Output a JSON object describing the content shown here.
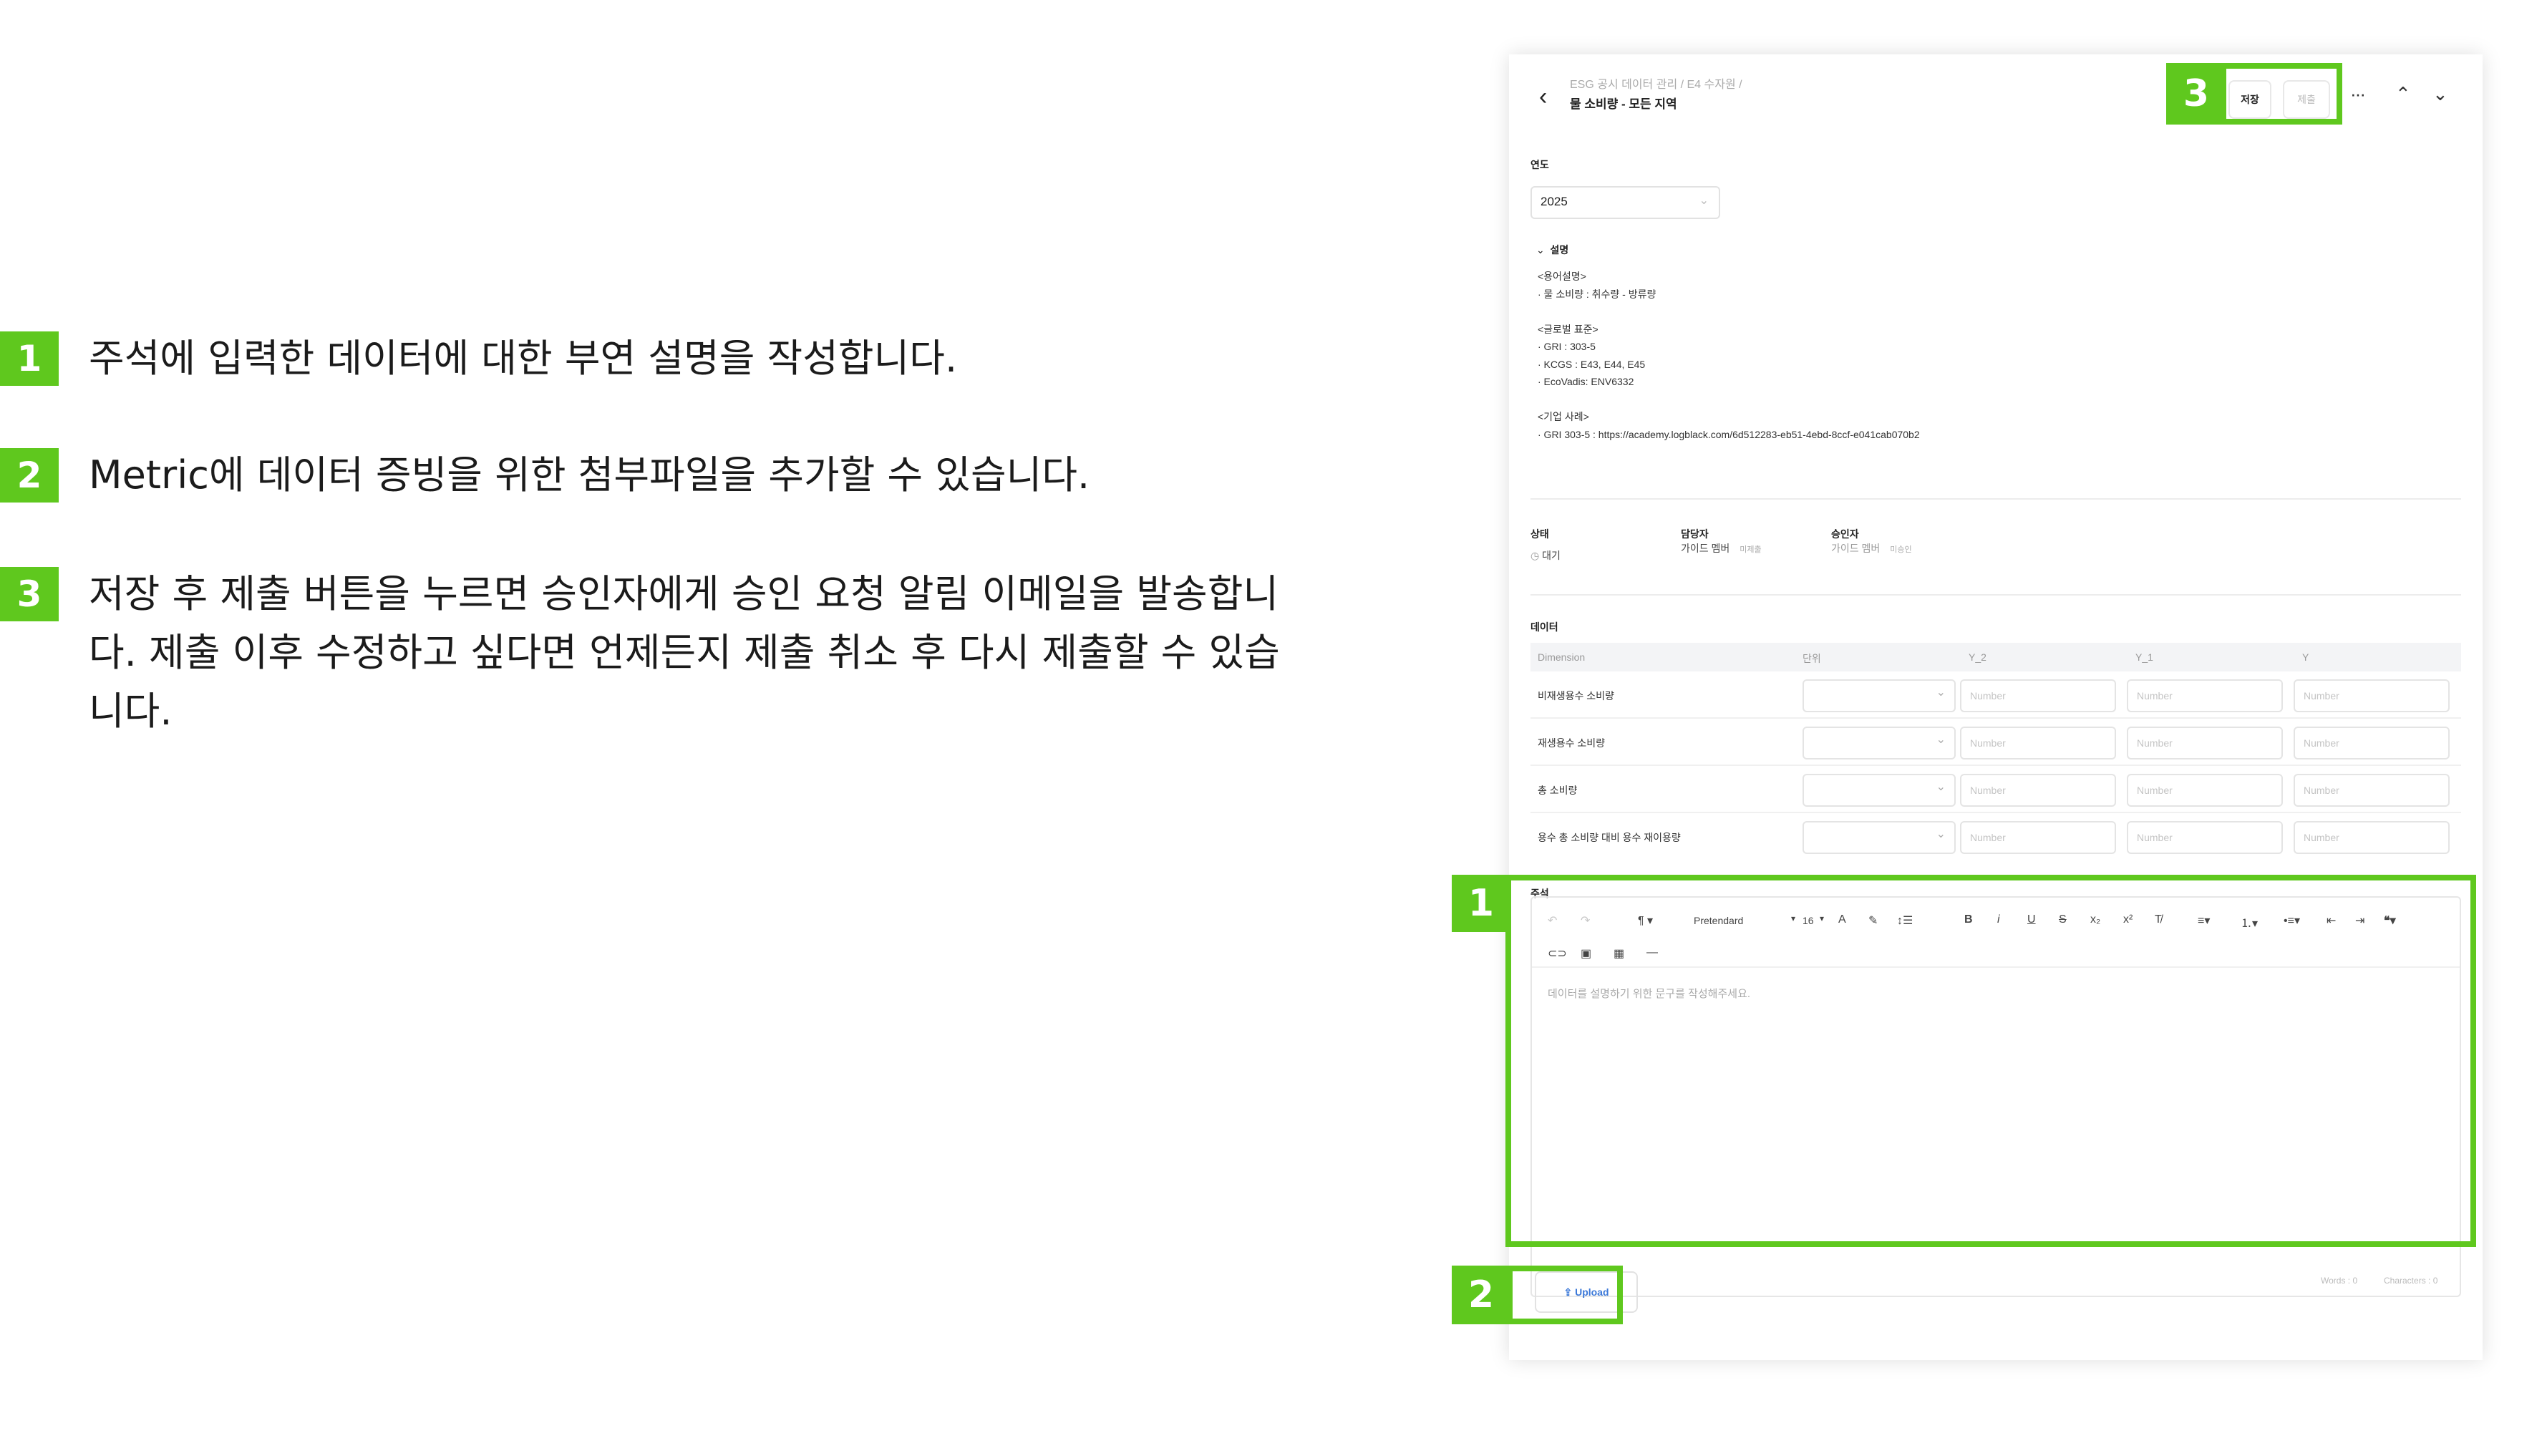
{
  "instructions": [
    {
      "num": "1",
      "text": "주석에 입력한 데이터에 대한 부연 설명을 작성합니다."
    },
    {
      "num": "2",
      "text": "Metric에 데이터 증빙을 위한 첨부파일을 추가할 수 있습니다."
    },
    {
      "num": "3",
      "text": "저장 후 제출 버튼을 누르면 승인자에게 승인 요청 알림 이메일을 발송합니다. 제출 이후 수정하고 싶다면 언제든지 제출 취소 후 다시 제출할 수 있습니다."
    }
  ],
  "header": {
    "back_icon": "chevron-left-icon",
    "breadcrumb": "ESG 공시 데이터 관리 / E4 수자원 /",
    "title": "물 소비량 - 모든 지역",
    "save_label": "저장",
    "submit_label": "제출",
    "more_label": "···",
    "up_label": "⌃",
    "down_label": "⌄"
  },
  "year": {
    "label": "연도",
    "value": "2025"
  },
  "description": {
    "toggle_label": "설명",
    "lines": [
      "<용어설명>",
      "· 물 소비량 : 취수량 - 방류량",
      "",
      "<글로벌 표준>",
      "· GRI : 303-5",
      "· KCGS : E43, E44, E45",
      "· EcoVadis: ENV6332",
      "",
      "<기업 사례>",
      "· GRI 303-5 : https://academy.logblack.com/6d512283-eb51-4ebd-8ccf-e041cab070b2"
    ]
  },
  "status": {
    "status_label": "상태",
    "status_value": "대기",
    "owner_label": "담당자",
    "owner_value": "가이드 멤버",
    "owner_sub": "미제출",
    "approver_label": "승인자",
    "approver_value": "가이드 멤버",
    "approver_sub": "미승인"
  },
  "data_table": {
    "label": "데이터",
    "columns": [
      "Dimension",
      "단위",
      "Y_2",
      "Y_1",
      "Y"
    ],
    "placeholder": "Number",
    "rows": [
      "비재생용수 소비량",
      "재생용수 소비량",
      "총 소비량",
      "용수 총 소비량 대비 용수 재이용량"
    ]
  },
  "notes": {
    "label": "주석",
    "font_name": "Pretendard",
    "font_size": "16",
    "placeholder": "데이터를 설명하기 위한 문구를 작성해주세요.",
    "words": "Words : 0",
    "characters": "Characters : 0"
  },
  "upload_label": "Upload",
  "highlights": {
    "one": "1",
    "two": "2",
    "three": "3"
  },
  "accent_color": "#5fc81e"
}
